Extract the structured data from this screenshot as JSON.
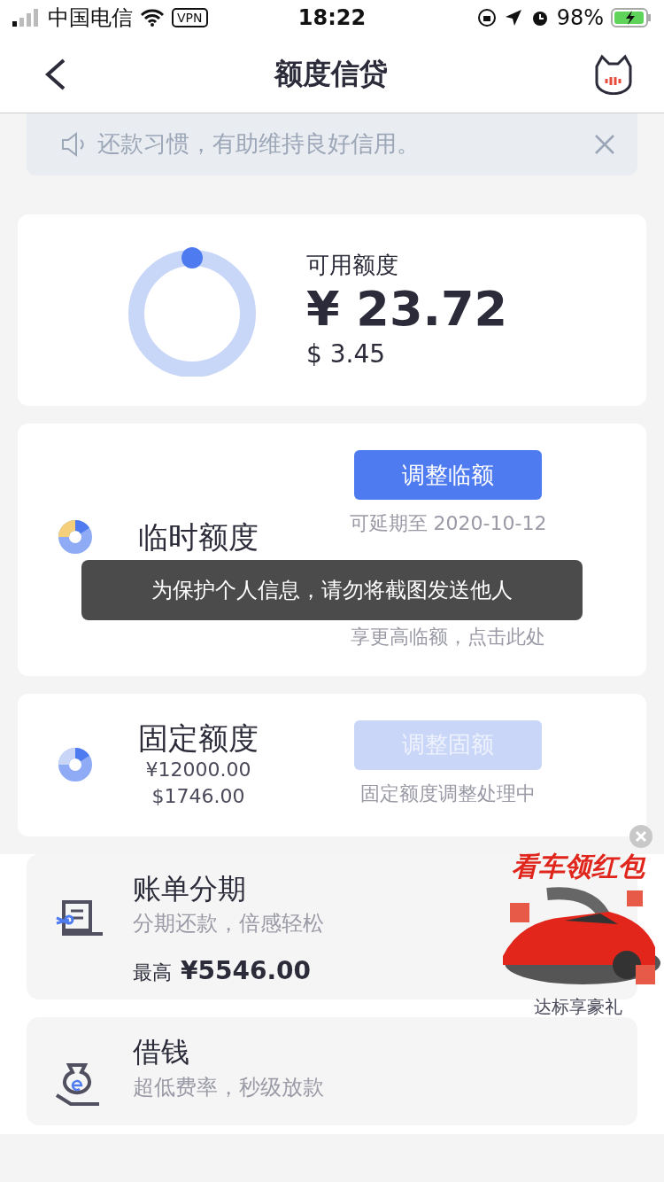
{
  "status_bar": {
    "carrier": "中国电信",
    "vpn": "VPN",
    "time": "18:22",
    "battery": "98%"
  },
  "nav": {
    "title": "额度信贷"
  },
  "notice": {
    "text": "还款习惯，有助维持良好信用。"
  },
  "available": {
    "label": "可用额度",
    "amount": "¥ 23.72",
    "secondary": "$ 3.45"
  },
  "quotas": [
    {
      "kind": "temporary",
      "title": "临时额度",
      "button": "调整临额",
      "disabled": false,
      "note": "可延期至 2020-10-12",
      "link": "享更高临额，点击此处"
    },
    {
      "kind": "fixed",
      "title": "固定额度",
      "amounts": [
        "¥12000.00",
        "$1746.00"
      ],
      "button": "调整固额",
      "disabled": true,
      "note": "固定额度调整处理中"
    }
  ],
  "toast": "为保护个人信息，请勿将截图发送他人",
  "services": [
    {
      "kind": "installment",
      "title": "账单分期",
      "subtitle": "分期还款，倍感轻松",
      "prefix": "最高",
      "amount": "¥5546.00"
    },
    {
      "kind": "loan",
      "title": "借钱",
      "subtitle": "超低费率，秒级放款"
    }
  ],
  "promo": {
    "title": "看车领红包",
    "caption": "达标享豪礼"
  }
}
